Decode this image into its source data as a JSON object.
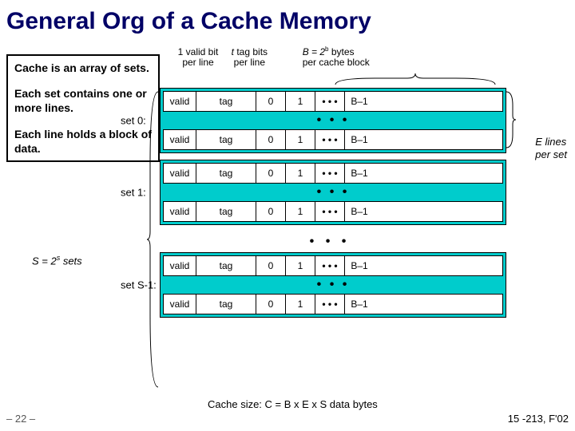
{
  "title": "General Org of a Cache Memory",
  "info": {
    "p1": "Cache is an array of sets.",
    "p2": "Each set contains one or more lines.",
    "p3": "Each line holds a block of data."
  },
  "labels": {
    "valid_bit": "1 valid bit per line",
    "tag_bits_1": "t",
    "tag_bits_2": " tag bits",
    "tag_bits_3": "per line",
    "bytes_1": "B = 2",
    "bytes_sup": "b",
    "bytes_2": " bytes",
    "bytes_3": "per cache block",
    "valid": "valid",
    "tag": "tag",
    "b0": "0",
    "b1": "1",
    "dots": "• • •",
    "blast": "B–1",
    "set0": "set 0:",
    "set1": "set 1:",
    "setS1": "set S-1:",
    "s_sets_1": "S = 2",
    "s_sets_sup": "s",
    "s_sets_2": " sets",
    "e_lines_1": "E",
    "e_lines_2": "  lines",
    "e_lines_3": "per set",
    "cache_size": "Cache size:  C = B x E x S data bytes"
  },
  "footer": {
    "left": "– 22 –",
    "right": "15 -213,  F'02"
  }
}
